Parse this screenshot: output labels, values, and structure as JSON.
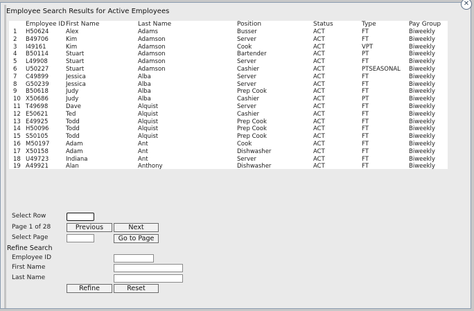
{
  "title": "Employee Search Results for Active Employees",
  "close_label": "✕",
  "columns": [
    "",
    "Employee ID",
    "First Name",
    "Last Name",
    "Position",
    "Status",
    "Type",
    "Pay Group"
  ],
  "rows": [
    [
      "1",
      "H50624",
      "Alex",
      "Adams",
      "Busser",
      "ACT",
      "FT",
      "Biweekly"
    ],
    [
      "2",
      "B49706",
      "Kim",
      "Adamson",
      "Server",
      "ACT",
      "FT",
      "Biweekly"
    ],
    [
      "3",
      "I49161",
      "Kim",
      "Adamson",
      "Cook",
      "ACT",
      "VPT",
      "Biweekly"
    ],
    [
      "4",
      "B50114",
      "Stuart",
      "Adamson",
      "Bartender",
      "ACT",
      "PT",
      "Biweekly"
    ],
    [
      "5",
      "L49908",
      "Stuart",
      "Adamson",
      "Server",
      "ACT",
      "FT",
      "Biweekly"
    ],
    [
      "6",
      "U50227",
      "Stuart",
      "Adamson",
      "Cashier",
      "ACT",
      "PTSEASONAL",
      "Biweekly"
    ],
    [
      "7",
      "C49899",
      "Jessica",
      "Alba",
      "Server",
      "ACT",
      "FT",
      "Biweekly"
    ],
    [
      "8",
      "G50239",
      "Jessica",
      "Alba",
      "Server",
      "ACT",
      "FT",
      "Biweekly"
    ],
    [
      "9",
      "B50618",
      "Judy",
      "Alba",
      "Prep Cook",
      "ACT",
      "FT",
      "Biweekly"
    ],
    [
      "10",
      "X50686",
      "Judy",
      "Alba",
      "Cashier",
      "ACT",
      "PT",
      "Biweekly"
    ],
    [
      "11",
      "T49698",
      "Dave",
      "Alquist",
      "Server",
      "ACT",
      "FT",
      "Biweekly"
    ],
    [
      "12",
      "E50621",
      "Ted",
      "Alquist",
      "Cashier",
      "ACT",
      "FT",
      "Biweekly"
    ],
    [
      "13",
      "E49925",
      "Todd",
      "Alquist",
      "Prep Cook",
      "ACT",
      "FT",
      "Biweekly"
    ],
    [
      "14",
      "H50096",
      "Todd",
      "Alquist",
      "Prep Cook",
      "ACT",
      "FT",
      "Biweekly"
    ],
    [
      "15",
      "S50105",
      "Todd",
      "Alquist",
      "Prep Cook",
      "ACT",
      "FT",
      "Biweekly"
    ],
    [
      "16",
      "M50197",
      "Adam",
      "Ant",
      "Cook",
      "ACT",
      "FT",
      "Biweekly"
    ],
    [
      "17",
      "X50158",
      "Adam",
      "Ant",
      "Dishwasher",
      "ACT",
      "FT",
      "Biweekly"
    ],
    [
      "18",
      "U49723",
      "Indiana",
      "Ant",
      "Server",
      "ACT",
      "FT",
      "Biweekly"
    ],
    [
      "19",
      "A49921",
      "Alan",
      "Anthony",
      "Dishwasher",
      "ACT",
      "FT",
      "Biweekly"
    ]
  ],
  "nav": {
    "select_row_label": "Select Row",
    "select_row_value": "",
    "page_info": "Page 1 of 28",
    "previous_label": "Previous",
    "next_label": "Next",
    "select_page_label": "Select Page",
    "select_page_value": "",
    "go_to_page_label": "Go to Page"
  },
  "refine": {
    "header": "Refine Search",
    "employee_id_label": "Employee ID",
    "first_name_label": "First Name",
    "last_name_label": "Last Name",
    "employee_id_value": "",
    "first_name_value": "",
    "last_name_value": "",
    "refine_label": "Refine",
    "reset_label": "Reset"
  }
}
